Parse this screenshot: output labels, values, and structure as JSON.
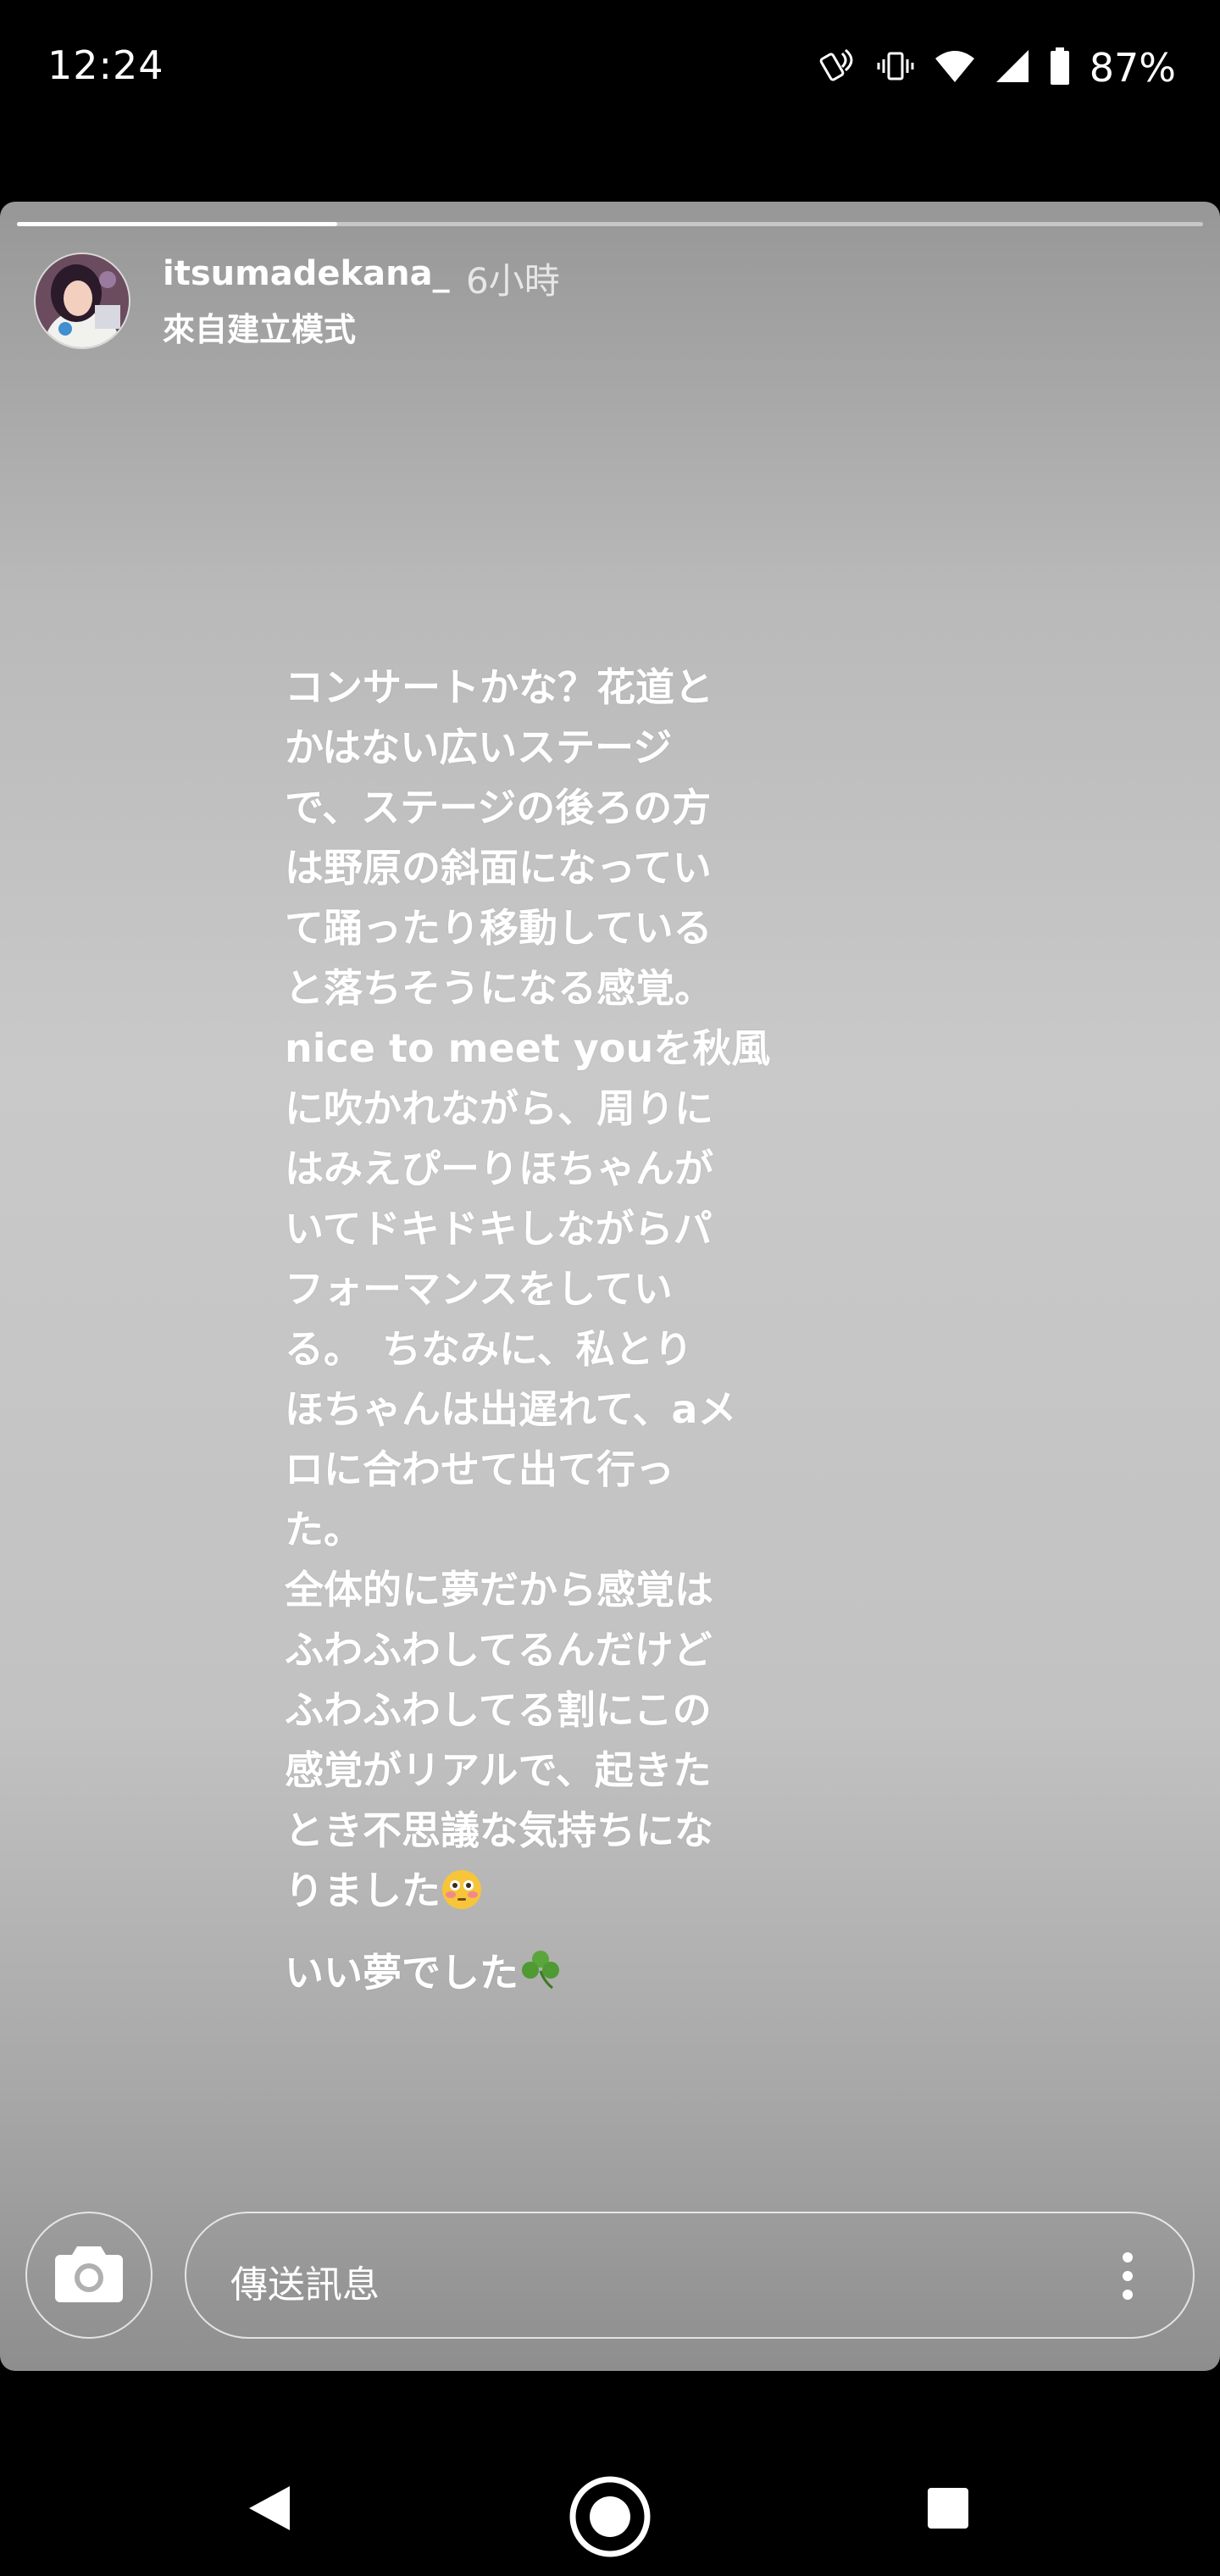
{
  "status_bar": {
    "time": "12:24",
    "battery": "87%",
    "icons": [
      "nfc-phone-icon",
      "vibrate-icon",
      "wifi-icon",
      "cell-signal-icon",
      "battery-icon"
    ]
  },
  "story": {
    "progress": 0.27,
    "username": "itsumadekana_",
    "time_ago": "6小時",
    "subtitle": "來自建立模式",
    "text_lines": [
      "コンサートかな？花道と",
      "かはない広いステージ",
      "で、ステージの後ろの方",
      "は野原の斜面になってい",
      "て踊ったり移動している",
      "と落ちそうになる感覚。",
      "nice to meet youを秋風",
      "に吹かれながら、周りに",
      "はみえぴーりほちゃんが",
      "いてドキドキしながらパ",
      "フォーマンスをしてい",
      "る。　ちなみに、私とり",
      "ほちゃんは出遅れて、aメ",
      "ロに合わせて出て行っ",
      "た。",
      "全体的に夢だから感覚は",
      "ふわふわしてるんだけど",
      "ふわふわしてる割にこの",
      "感覚がリアルで、起きた",
      "とき不思議な気持ちにな"
    ],
    "last_line": "りました",
    "final_line": "いい夢でした"
  },
  "composer": {
    "placeholder": "傳送訊息"
  },
  "colors": {
    "background": "#000000",
    "story_gray": "#c4c4c4",
    "text": "#ffffff"
  }
}
